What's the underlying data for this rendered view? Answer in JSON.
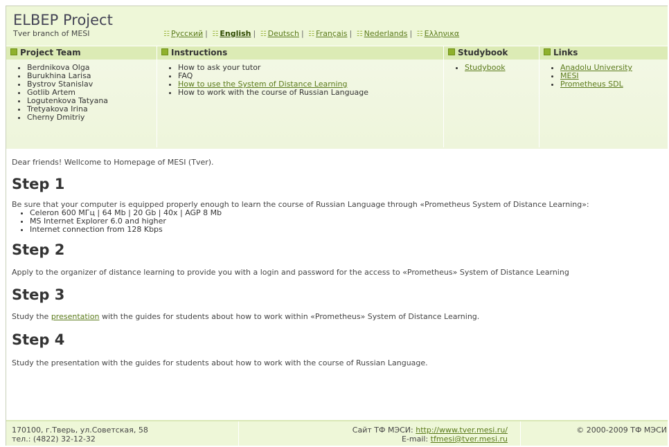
{
  "header": {
    "title": "ELBEP Project",
    "subtitle": "Tver branch of MESI",
    "languages": [
      {
        "label": "Русский",
        "current": false
      },
      {
        "label": "English",
        "current": true
      },
      {
        "label": "Deutsch",
        "current": false
      },
      {
        "label": "Français",
        "current": false
      },
      {
        "label": "Nederlands",
        "current": false
      },
      {
        "label": "Ελληνικα",
        "current": false
      }
    ]
  },
  "columns": {
    "team": {
      "heading": "Project Team",
      "items": [
        "Berdnikova Olga",
        "Burukhina Larisa",
        "Bystrov Stanislav",
        "Gotlib Artem",
        "Logutenkova Tatyana",
        "Tretyakova Irina",
        "Cherny Dmitriy"
      ]
    },
    "instructions": {
      "heading": "Instructions",
      "items": [
        "How to ask your tutor",
        "FAQ",
        "How to use the System of Distance Learning",
        "How to work with the course of Russian Language"
      ]
    },
    "studybook": {
      "heading": "Studybook",
      "items": [
        "Studybook"
      ]
    },
    "links": {
      "heading": "Links",
      "items": [
        "Anadolu University",
        "MESI",
        "Prometheus SDL"
      ]
    }
  },
  "main": {
    "intro": "Dear friends! Wellcome to Homepage of MESI (Tver).",
    "step1": {
      "title": "Step 1",
      "text": "Be sure that your computer is equipped properly enough to learn the course of Russian Language through «Prometheus System of Distance Learning»:",
      "items": [
        "Celeron 600 МГц | 64 Mb | 20 Gb | 40x | AGP 8 Mb",
        "MS Internet Explorer 6.0 and higher",
        "Internet connection from 128 Kbps"
      ]
    },
    "step2": {
      "title": "Step 2",
      "text": "Apply to the organizer of distance learning to provide you with a login and password for the access to «Prometheus» System of Distance Learning"
    },
    "step3": {
      "title": "Step 3",
      "text_before": "Study the ",
      "link": "presentation",
      "text_after": " with the guides for students about how to work within «Prometheus» System of Distance Learning."
    },
    "step4": {
      "title": "Step 4",
      "text": "Study the presentation with the guides for students about how to work with the course of Russian Language."
    }
  },
  "footer": {
    "address": "170100, г.Тверь, ул.Советская, 58",
    "phone": "тел.: (4822) 32-12-32",
    "site_label": "Сайт ТФ МЭСИ: ",
    "site_url": "http://www.tver.mesi.ru/",
    "email_label": "E-mail: ",
    "email": "tfmesi@tver.mesi.ru",
    "copyright": "© 2000-2009 ТФ МЭСИ"
  },
  "colors": {
    "header_bg": "#eef7d8",
    "column_head_bg": "#dcebb5",
    "link": "#5a7a1a",
    "bullet": "#8fb12c"
  }
}
